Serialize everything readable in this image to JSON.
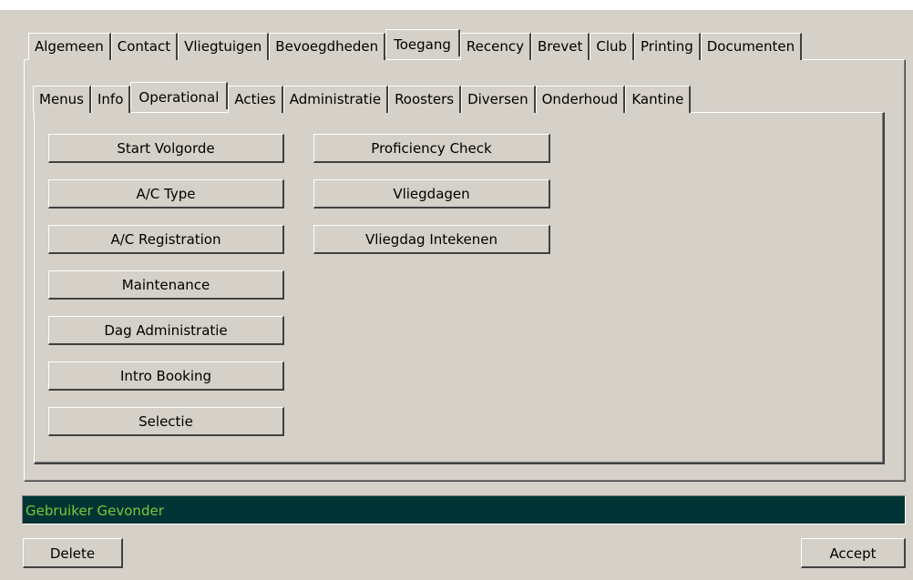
{
  "main_tabs": [
    {
      "label": "Algemeen",
      "active": false
    },
    {
      "label": "Contact",
      "active": false
    },
    {
      "label": "Vliegtuigen",
      "active": false
    },
    {
      "label": "Bevoegdheden",
      "active": false
    },
    {
      "label": "Toegang",
      "active": true
    },
    {
      "label": "Recency",
      "active": false
    },
    {
      "label": "Brevet",
      "active": false
    },
    {
      "label": "Club",
      "active": false
    },
    {
      "label": "Printing",
      "active": false
    },
    {
      "label": "Documenten",
      "active": false
    }
  ],
  "sub_tabs": [
    {
      "label": "Menus",
      "active": false
    },
    {
      "label": "Info",
      "active": false
    },
    {
      "label": "Operational",
      "active": true
    },
    {
      "label": "Acties",
      "active": false
    },
    {
      "label": "Administratie",
      "active": false
    },
    {
      "label": "Roosters",
      "active": false
    },
    {
      "label": "Diversen",
      "active": false
    },
    {
      "label": "Onderhoud",
      "active": false
    },
    {
      "label": "Kantine",
      "active": false
    }
  ],
  "buttons_left": [
    "Start Volgorde",
    "A/C Type",
    "A/C Registration",
    "Maintenance",
    "Dag Administratie",
    "Intro Booking",
    "Selectie"
  ],
  "buttons_right": [
    "Proficiency Check",
    "Vliegdagen",
    "Vliegdag Intekenen"
  ],
  "status": {
    "text": "Gebruiker Gevonder",
    "background": "#003333",
    "color": "#7cc83a"
  },
  "footer": {
    "delete_label": "Delete",
    "accept_label": "Accept"
  }
}
